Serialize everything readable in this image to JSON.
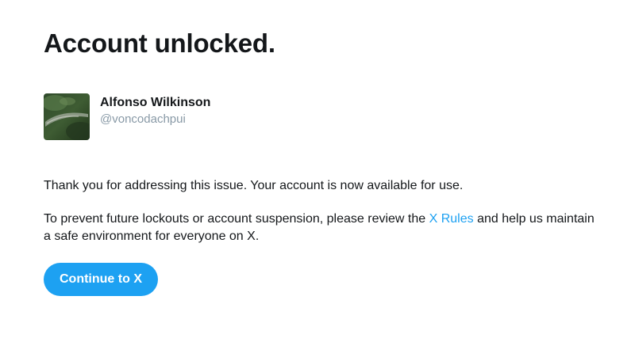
{
  "heading": "Account unlocked.",
  "account": {
    "display_name": "Alfonso Wilkinson",
    "handle": "@voncodachpui"
  },
  "body": {
    "paragraph1": "Thank you for addressing this issue. Your account is now available for use.",
    "paragraph2_before_link": "To prevent future lockouts or account suspension, please review the ",
    "rules_link": "X Rules",
    "paragraph2_after_link": " and help us maintain a safe environment for everyone on X."
  },
  "primary_action": {
    "label": "Continue to X"
  },
  "colors": {
    "accent": "#1da1f2",
    "text": "#14171a",
    "muted": "#8899a6"
  }
}
